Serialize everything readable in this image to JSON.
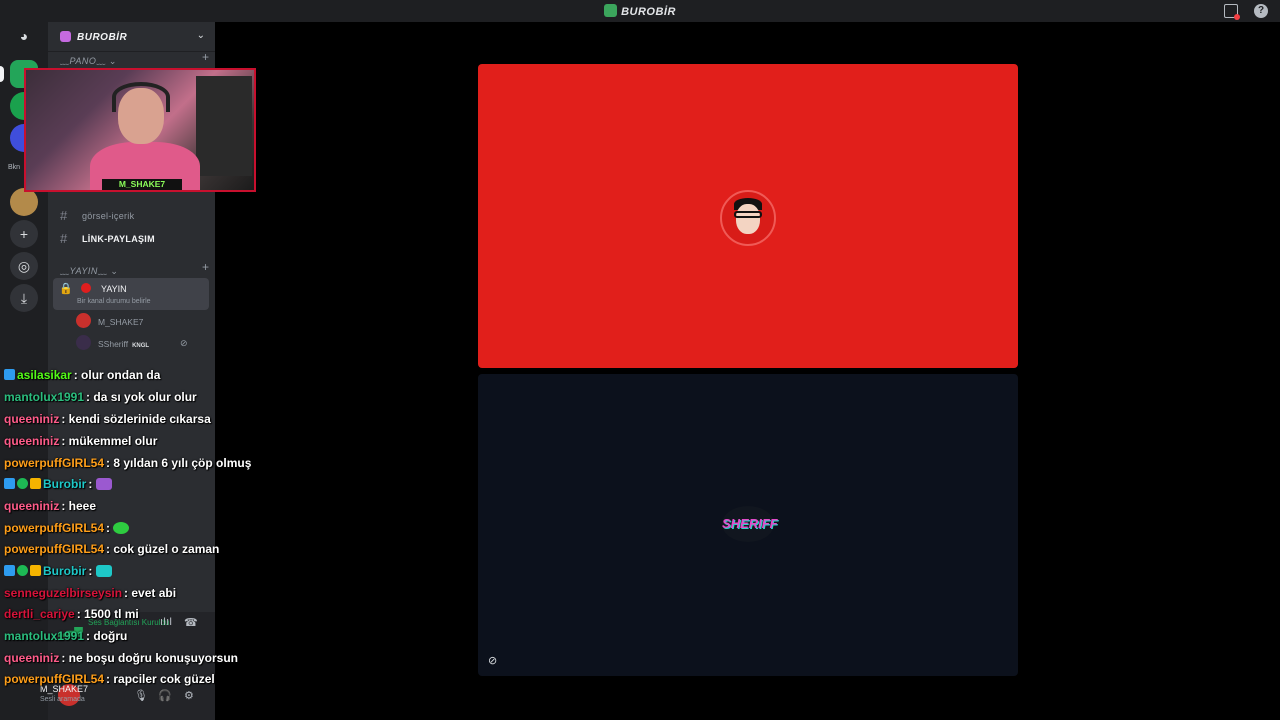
{
  "window": {
    "title": "BUROBİR"
  },
  "titlebar": {
    "inbox_icon": "inbox-icon",
    "help_icon": "help-icon"
  },
  "rail": {
    "icons": [
      "discord-home-icon",
      "add-server-icon",
      "explore-icon",
      "download-icon"
    ],
    "server_label": "Bkn"
  },
  "guild": {
    "name": "BUROBİR"
  },
  "categories": {
    "pano": "PANO",
    "yayin": "YAYIN"
  },
  "channels": [
    {
      "name": "görsel-içerik",
      "active": false
    },
    {
      "name": "LİNK-PAYLAŞIM",
      "active": true
    }
  ],
  "voice_channel": {
    "name": "YAYIN",
    "status_placeholder": "Bir kanal durumu belirle",
    "users": [
      {
        "name": "M_SHAKE7",
        "badge": ""
      },
      {
        "name": "SSheriff",
        "badge": "KNGL"
      }
    ]
  },
  "voice_panel": {
    "status": "Ses Bağlantısı Kuruldu"
  },
  "user_panel": {
    "username": "M_SHAKE7",
    "status": "Sesli aramada"
  },
  "webcam": {
    "nameplate": "M_SHAKE7"
  },
  "chat": {
    "messages": [
      {
        "user": "asilasikar",
        "color": "#53fc18",
        "text": ": olur ondan da"
      },
      {
        "user": "mantolux1991",
        "color": "#2bbd7e",
        "text": ": da sı yok olur olur"
      },
      {
        "user": "queeniniz",
        "color": "#ff5c8a",
        "text": ": kendi sözlerinide cıkarsa"
      },
      {
        "user": "queeniniz",
        "color": "#ff5c8a",
        "text": ": mükemmel olur"
      },
      {
        "user": "powerpuffGIRL54",
        "color": "#ff9f1a",
        "text": ": 8 yıldan 6 yılı çöp olmuş"
      },
      {
        "user": "Burobir",
        "color": "#1ec8c8",
        "text": ":"
      },
      {
        "user": "queeniniz",
        "color": "#ff5c8a",
        "text": ": heee"
      },
      {
        "user": "powerpuffGIRL54",
        "color": "#ff9f1a",
        "text": ":"
      },
      {
        "user": "powerpuffGIRL54",
        "color": "#ff9f1a",
        "text": ": cok güzel o zaman"
      },
      {
        "user": "Burobir",
        "color": "#1ec8c8",
        "text": ":"
      },
      {
        "user": "senneguzelbirseysin",
        "color": "#d6133a",
        "text": ": evet abi"
      },
      {
        "user": "dertli_cariye",
        "color": "#d6133a",
        "text": ": 1500 tl mi"
      },
      {
        "user": "mantolux1991",
        "color": "#2bbd7e",
        "text": ": doğru"
      },
      {
        "user": "queeniniz",
        "color": "#ff5c8a",
        "text": ": ne boşu doğru konuşuyorsun"
      },
      {
        "user": "powerpuffGIRL54",
        "color": "#ff9f1a",
        "text": ": rapciler cok güzel"
      }
    ]
  },
  "stage": {
    "tile1": {
      "color": "#e11f1b"
    },
    "tile2": {
      "logo_text": "SHERIFF"
    }
  }
}
